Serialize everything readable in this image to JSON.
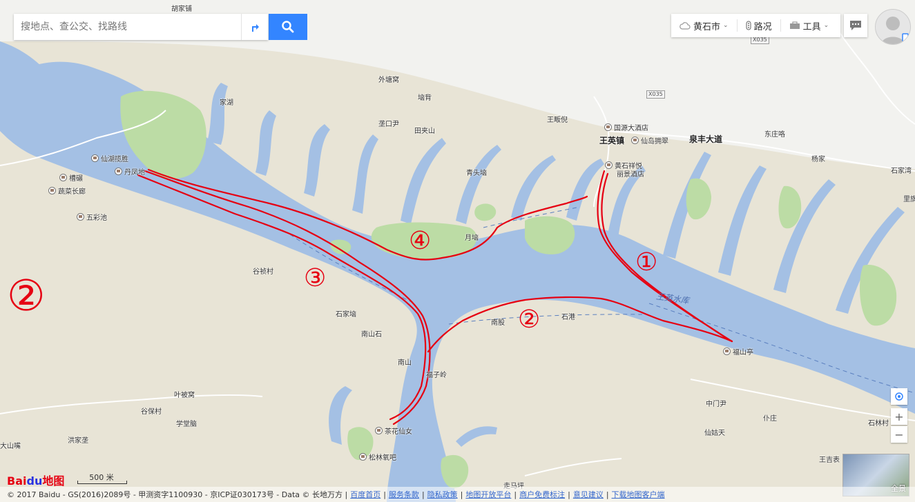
{
  "search": {
    "placeholder": "搜地点、查公交、找路线"
  },
  "toolbar": {
    "city": "黄石市",
    "traffic": "路况",
    "tools": "工具"
  },
  "places": {
    "hujiawan": "胡家铺",
    "jiahu": "家湖",
    "waitangwo": "外塘窝",
    "tanbei": "垴背",
    "wangfanni": "王畈倪",
    "dongzhuang": "东庄咯",
    "yangjia": "杨家",
    "shijiawan": "石家湾",
    "libian": "里旗",
    "kongkouyin": "垄口尹",
    "tianjiashan": "田夹山",
    "qingtouduo": "青头垴",
    "yueduo": "月垴",
    "wangyingzhen": "王英镇",
    "quanfengdadao": "泉丰大道",
    "gusicun": "谷祯村",
    "shijiaduo": "石家垴",
    "nanshanshi": "南山石",
    "nanshan": "南山",
    "nanpan": "南股",
    "shigang": "石港",
    "fuzijing": "福子岭",
    "yebeiwo": "叶被窝",
    "gubaocun": "谷保村",
    "xuetangnao": "学堂脑",
    "hongjiaping": "洪家垄",
    "dashanzui": "大山嘴",
    "zhongmenyin": "中门尹",
    "puzhuang": "仆庄",
    "xiangutian": "仙姑天",
    "shilincun": "石林村",
    "wangjibiao": "王吉表",
    "zoumaping": "走马坪",
    "shijiawan2": "石家湾"
  },
  "pois": {
    "xianhu": "仙湖揽胜",
    "danfeng": "丹凤地",
    "caobi": "槽碾",
    "shucai": "蔬菜长廊",
    "wucaichi": "五彩池",
    "guoyuan": "国源大酒店",
    "xiandao": "仙岛拥翠",
    "huangshixiangyue": "黄石祥悦",
    "lijing": "丽景酒店",
    "fushanting": "福山亭",
    "chahua": "茶花仙女",
    "songlin": "松林氧吧"
  },
  "water": {
    "reservoir": "王英水库"
  },
  "markers": {
    "m1": "①",
    "m2": "②",
    "m3": "③",
    "m4": "④",
    "m2_left": "②"
  },
  "shields": {
    "x035a": "X035",
    "x035b": "X035"
  },
  "controls": {
    "zoom_in": "+",
    "zoom_out": "−",
    "panorama": "全景"
  },
  "scale": {
    "label": "500 米"
  },
  "logo": {
    "bai": "Bai",
    "du": "du",
    "ditu": "地图"
  },
  "footer": {
    "copyright": "© 2017 Baidu - GS(2016)2089号 - 甲测资字1100930 - 京ICP证030173号 - Data © 长地万方 |",
    "links": [
      "百度首页",
      "服务条款",
      "隐私政策",
      "地图开放平台",
      "商户免费标注",
      "意见建议",
      "下载地图客户端"
    ]
  },
  "colors": {
    "land": "#e8e4d6",
    "water": "#a4c0e4",
    "forest": "#bcdca5",
    "route": "#e60012",
    "accent": "#3385ff"
  }
}
